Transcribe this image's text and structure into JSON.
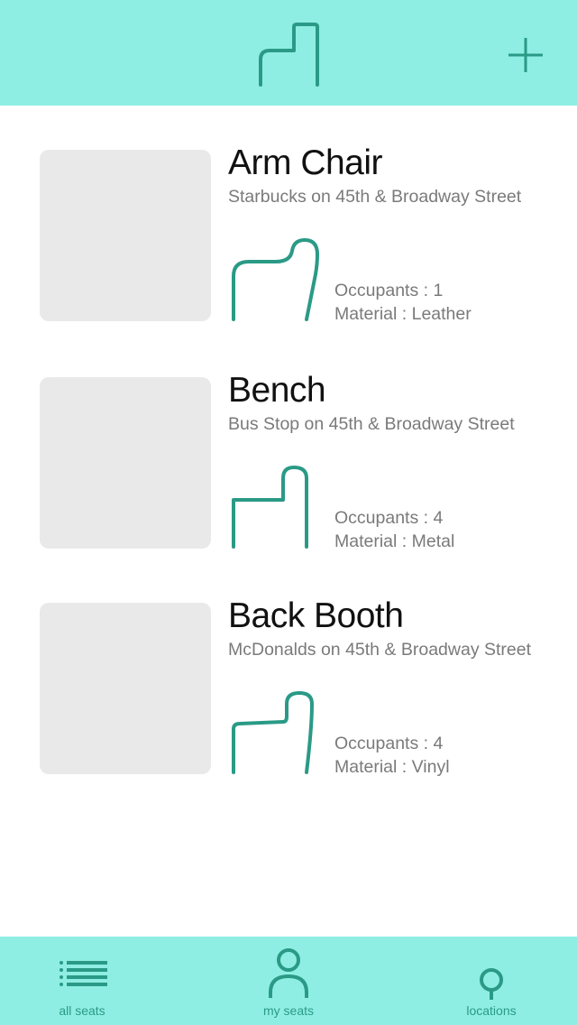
{
  "colors": {
    "header_bg": "#8feee3",
    "accent": "#2a9a86",
    "thumb_bg": "#e9e9e9",
    "meta_text": "#7a7a7a"
  },
  "header": {
    "logo_icon": "seat-logo-icon",
    "add_icon": "plus-icon"
  },
  "seats": [
    {
      "title": "Arm Chair",
      "location": "Starbucks on 45th & Broadway Street",
      "occupants": "Occupants : 1",
      "material": "Material : Leather",
      "icon": "armchair-icon"
    },
    {
      "title": "Bench",
      "location": "Bus Stop on 45th & Broadway Street",
      "occupants": "Occupants : 4",
      "material": "Material : Metal",
      "icon": "bench-icon"
    },
    {
      "title": "Back Booth",
      "location": "McDonalds on 45th & Broadway Street",
      "occupants": "Occupants : 4",
      "material": "Material : Vinyl",
      "icon": "booth-icon"
    }
  ],
  "tabbar": {
    "items": [
      {
        "label": "all seats",
        "icon": "list-icon"
      },
      {
        "label": "my seats",
        "icon": "person-icon"
      },
      {
        "label": "locations",
        "icon": "location-pin-icon"
      }
    ]
  }
}
